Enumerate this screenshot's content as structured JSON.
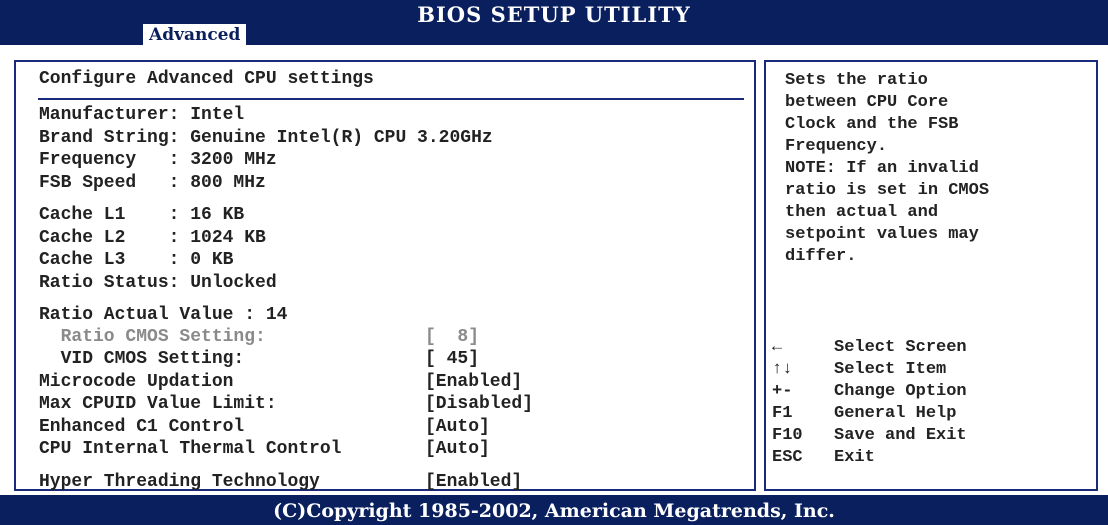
{
  "header": {
    "title": "BIOS SETUP UTILITY",
    "tab": "Advanced"
  },
  "main": {
    "section_title": "Configure Advanced CPU settings",
    "info": [
      "Manufacturer: Intel",
      "Brand String: Genuine Intel(R) CPU 3.20GHz",
      "Frequency   : 3200 MHz",
      "FSB Speed   : 800 MHz",
      "Cache L1    : 16 KB",
      "Cache L2    : 1024 KB",
      "Cache L3    : 0 KB",
      "Ratio Status: Unlocked",
      "Ratio Actual Value : 14"
    ],
    "settings": [
      {
        "label": "  Ratio CMOS Setting:",
        "value": "[  8]"
      },
      {
        "label": "  VID CMOS Setting:",
        "value": "[ 45]"
      },
      {
        "label": "Microcode Updation",
        "value": "[Enabled]"
      },
      {
        "label": "Max CPUID Value Limit:",
        "value": "[Disabled]"
      },
      {
        "label": "Enhanced C1 Control",
        "value": "[Auto]"
      },
      {
        "label": "CPU Internal Thermal Control",
        "value": "[Auto]"
      },
      {
        "label": "Hyper Threading Technology",
        "value": "[Enabled]"
      }
    ]
  },
  "help": {
    "text": "Sets the ratio\nbetween CPU Core\nClock and the FSB\nFrequency.\nNOTE: If an invalid\nratio is set in CMOS\nthen actual and\nsetpoint values may\ndiffer.",
    "keys": [
      {
        "key": "←",
        "action": "Select Screen"
      },
      {
        "key": "↑↓",
        "action": "Select Item"
      },
      {
        "key": "+-",
        "action": "Change Option"
      },
      {
        "key": "F1",
        "action": "General Help"
      },
      {
        "key": "F10",
        "action": "Save and Exit"
      },
      {
        "key": "ESC",
        "action": "Exit"
      }
    ]
  },
  "footer": {
    "copyright": "(C)Copyright 1985-2002, American Megatrends, Inc."
  },
  "colors": {
    "bar": "#0a1f5e",
    "border": "#1a2a7a",
    "text": "#222222",
    "disabled": "#8a8a8a"
  }
}
